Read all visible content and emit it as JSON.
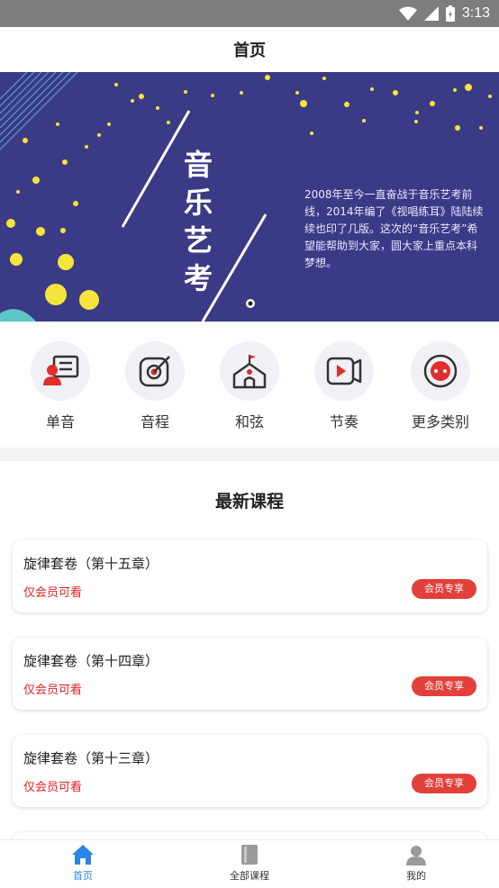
{
  "status_bar": {
    "time": "3:13"
  },
  "header": {
    "title": "首页"
  },
  "banner": {
    "vertical_title": [
      "音",
      "乐",
      "艺",
      "考"
    ],
    "description": "2008年至今一直奋战于音乐艺考前线，2014年编了《视唱练耳》陆陆续续也印了几版。这次的“音乐艺考”希望能帮助到大家，圆大家上重点本科梦想。",
    "background_color": "#3b3a86"
  },
  "categories": [
    {
      "label": "单音",
      "icon": "single-note-icon"
    },
    {
      "label": "音程",
      "icon": "interval-icon"
    },
    {
      "label": "和弦",
      "icon": "chord-icon"
    },
    {
      "label": "节奏",
      "icon": "rhythm-icon"
    },
    {
      "label": "更多类别",
      "icon": "more-categories-icon"
    }
  ],
  "latest": {
    "heading": "最新课程",
    "courses": [
      {
        "title": "旋律套卷（第十五章）",
        "subtitle": "仅会员可看",
        "badge": "会员专享"
      },
      {
        "title": "旋律套卷（第十四章）",
        "subtitle": "仅会员可看",
        "badge": "会员专享"
      },
      {
        "title": "旋律套卷（第十三章）",
        "subtitle": "仅会员可看",
        "badge": "会员专享"
      }
    ]
  },
  "tabs": [
    {
      "label": "首页",
      "icon": "home-icon",
      "active": true
    },
    {
      "label": "全部课程",
      "icon": "book-icon",
      "active": false
    },
    {
      "label": "我的",
      "icon": "user-icon",
      "active": false
    }
  ],
  "colors": {
    "accent_blue": "#2b85e4",
    "badge_red": "#e2403a",
    "member_text_red": "#e02020"
  }
}
